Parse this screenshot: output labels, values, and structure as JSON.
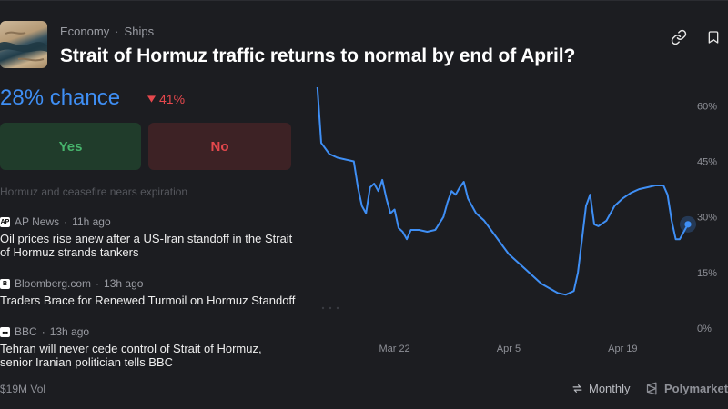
{
  "market": {
    "breadcrumb": [
      "Economy",
      "Ships"
    ],
    "title": "Strait of Hormuz traffic returns to normal by end of April?",
    "chance": "28% chance",
    "change": "41%",
    "change_direction": "down",
    "yes_label": "Yes",
    "no_label": "No",
    "volume": "$19M Vol"
  },
  "news": {
    "faded_headline": "Hormuz and ceasefire nears expiration",
    "items": [
      {
        "source": "AP News",
        "icon_text": "AP",
        "time": "11h ago",
        "headline": "Oil prices rise anew after a US-Iran standoff in the Strait of Hormuz strands tankers"
      },
      {
        "source": "Bloomberg.com",
        "icon_text": "B",
        "time": "13h ago",
        "headline": "Traders Brace for Renewed Turmoil on Hormuz Standoff"
      },
      {
        "source": "BBC",
        "icon_text": "■■■",
        "time": "13h ago",
        "headline": "Tehran will never cede control of Strait of Hormuz, senior Iranian politician tells BBC"
      }
    ]
  },
  "footer": {
    "timeframe_label": "Monthly",
    "brand": "Polymarket"
  },
  "colors": {
    "accent": "#3f8ff5",
    "yes": "#47b46c",
    "no": "#e5484d",
    "background": "#1c1d21"
  },
  "chart_data": {
    "type": "line",
    "y_ticks": [
      "60%",
      "45%",
      "30%",
      "15%",
      "0%"
    ],
    "x_ticks": [
      "Mar 22",
      "Apr 5",
      "Apr 19"
    ],
    "ylim": [
      0,
      65
    ],
    "grid": false,
    "series": [
      {
        "points": [
          [
            "2025-03-12",
            68
          ],
          [
            "2025-03-12T12",
            66
          ],
          [
            "2025-03-13",
            50
          ],
          [
            "2025-03-14",
            47
          ],
          [
            "2025-03-15",
            46
          ],
          [
            "2025-03-16",
            45.5
          ],
          [
            "2025-03-17",
            45
          ],
          [
            "2025-03-17T12",
            38
          ],
          [
            "2025-03-18",
            33
          ],
          [
            "2025-03-18T12",
            31
          ],
          [
            "2025-03-19",
            38
          ],
          [
            "2025-03-19T12",
            39
          ],
          [
            "2025-03-20",
            37
          ],
          [
            "2025-03-20T12",
            40
          ],
          [
            "2025-03-21",
            35
          ],
          [
            "2025-03-21T12",
            31
          ],
          [
            "2025-03-22",
            32
          ],
          [
            "2025-03-22T12",
            27
          ],
          [
            "2025-03-23",
            26
          ],
          [
            "2025-03-23T12",
            24
          ],
          [
            "2025-03-24",
            26.5
          ],
          [
            "2025-03-25",
            26.5
          ],
          [
            "2025-03-26",
            26
          ],
          [
            "2025-03-27",
            26.5
          ],
          [
            "2025-03-28",
            30
          ],
          [
            "2025-03-28T12",
            34
          ],
          [
            "2025-03-29",
            37
          ],
          [
            "2025-03-29T12",
            36
          ],
          [
            "2025-03-30",
            38
          ],
          [
            "2025-03-30T12",
            39.5
          ],
          [
            "2025-03-31",
            35
          ],
          [
            "2025-04-01",
            31
          ],
          [
            "2025-04-02",
            29
          ],
          [
            "2025-04-03",
            26
          ],
          [
            "2025-04-05",
            20
          ],
          [
            "2025-04-07",
            16
          ],
          [
            "2025-04-09",
            12
          ],
          [
            "2025-04-11",
            9.5
          ],
          [
            "2025-04-12",
            9
          ],
          [
            "2025-04-13",
            10
          ],
          [
            "2025-04-13T12",
            15
          ],
          [
            "2025-04-14",
            24
          ],
          [
            "2025-04-14T12",
            33
          ],
          [
            "2025-04-15",
            36
          ],
          [
            "2025-04-15T12",
            28
          ],
          [
            "2025-04-16",
            27.5
          ],
          [
            "2025-04-17",
            29
          ],
          [
            "2025-04-18",
            33
          ],
          [
            "2025-04-19",
            35
          ],
          [
            "2025-04-20",
            36.5
          ],
          [
            "2025-04-21",
            37.5
          ],
          [
            "2025-04-22",
            38
          ],
          [
            "2025-04-23",
            38.5
          ],
          [
            "2025-04-24",
            38.5
          ],
          [
            "2025-04-24T12",
            36
          ],
          [
            "2025-04-25",
            29
          ],
          [
            "2025-04-25T12",
            24
          ],
          [
            "2025-04-26",
            24
          ],
          [
            "2025-04-26T12",
            26
          ],
          [
            "2025-04-27",
            28
          ]
        ]
      }
    ]
  }
}
